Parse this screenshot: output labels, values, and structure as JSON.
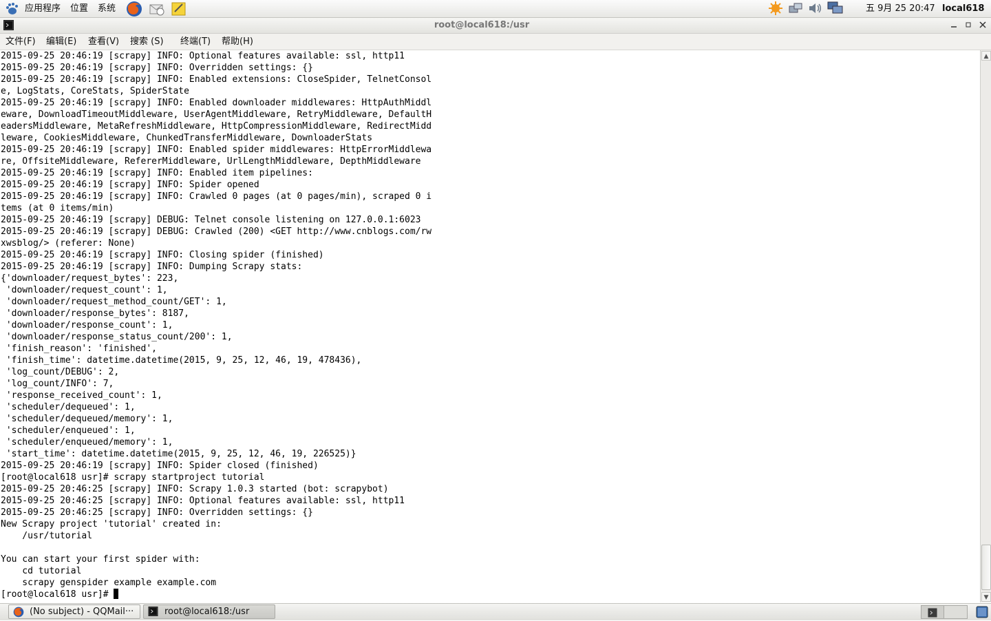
{
  "top_panel": {
    "menus": [
      "应用程序",
      "位置",
      "系统"
    ],
    "clock": "五 9月 25 20:47",
    "user": "local618",
    "launchers": [
      "firefox-icon",
      "mail-icon",
      "notes-icon"
    ],
    "tray": [
      "update-icon",
      "network-icon",
      "volume-icon",
      "display-icon"
    ]
  },
  "window": {
    "title": "root@local618:/usr",
    "buttons": [
      "minimize",
      "maximize",
      "close"
    ]
  },
  "menubar": {
    "items": [
      "文件(F)",
      "编辑(E)",
      "查看(V)",
      "搜索 (S)",
      "终端(T)",
      "帮助(H)"
    ]
  },
  "terminal": {
    "lines": [
      "2015-09-25 20:46:19 [scrapy] INFO: Optional features available: ssl, http11",
      "2015-09-25 20:46:19 [scrapy] INFO: Overridden settings: {}",
      "2015-09-25 20:46:19 [scrapy] INFO: Enabled extensions: CloseSpider, TelnetConsol",
      "e, LogStats, CoreStats, SpiderState",
      "2015-09-25 20:46:19 [scrapy] INFO: Enabled downloader middlewares: HttpAuthMiddl",
      "eware, DownloadTimeoutMiddleware, UserAgentMiddleware, RetryMiddleware, DefaultH",
      "eadersMiddleware, MetaRefreshMiddleware, HttpCompressionMiddleware, RedirectMidd",
      "leware, CookiesMiddleware, ChunkedTransferMiddleware, DownloaderStats",
      "2015-09-25 20:46:19 [scrapy] INFO: Enabled spider middlewares: HttpErrorMiddlewa",
      "re, OffsiteMiddleware, RefererMiddleware, UrlLengthMiddleware, DepthMiddleware",
      "2015-09-25 20:46:19 [scrapy] INFO: Enabled item pipelines:",
      "2015-09-25 20:46:19 [scrapy] INFO: Spider opened",
      "2015-09-25 20:46:19 [scrapy] INFO: Crawled 0 pages (at 0 pages/min), scraped 0 i",
      "tems (at 0 items/min)",
      "2015-09-25 20:46:19 [scrapy] DEBUG: Telnet console listening on 127.0.0.1:6023",
      "2015-09-25 20:46:19 [scrapy] DEBUG: Crawled (200) <GET http://www.cnblogs.com/rw",
      "xwsblog/> (referer: None)",
      "2015-09-25 20:46:19 [scrapy] INFO: Closing spider (finished)",
      "2015-09-25 20:46:19 [scrapy] INFO: Dumping Scrapy stats:",
      "{'downloader/request_bytes': 223,",
      " 'downloader/request_count': 1,",
      " 'downloader/request_method_count/GET': 1,",
      " 'downloader/response_bytes': 8187,",
      " 'downloader/response_count': 1,",
      " 'downloader/response_status_count/200': 1,",
      " 'finish_reason': 'finished',",
      " 'finish_time': datetime.datetime(2015, 9, 25, 12, 46, 19, 478436),",
      " 'log_count/DEBUG': 2,",
      " 'log_count/INFO': 7,",
      " 'response_received_count': 1,",
      " 'scheduler/dequeued': 1,",
      " 'scheduler/dequeued/memory': 1,",
      " 'scheduler/enqueued': 1,",
      " 'scheduler/enqueued/memory': 1,",
      " 'start_time': datetime.datetime(2015, 9, 25, 12, 46, 19, 226525)}",
      "2015-09-25 20:46:19 [scrapy] INFO: Spider closed (finished)",
      "[root@local618 usr]# scrapy startproject tutorial",
      "2015-09-25 20:46:25 [scrapy] INFO: Scrapy 1.0.3 started (bot: scrapybot)",
      "2015-09-25 20:46:25 [scrapy] INFO: Optional features available: ssl, http11",
      "2015-09-25 20:46:25 [scrapy] INFO: Overridden settings: {}",
      "New Scrapy project 'tutorial' created in:",
      "    /usr/tutorial",
      "",
      "You can start your first spider with:",
      "    cd tutorial",
      "    scrapy genspider example example.com"
    ],
    "prompt": "[root@local618 usr]# "
  },
  "taskbar": {
    "tasks": [
      {
        "label": "(No subject) - QQMail···",
        "icon": "firefox-icon"
      },
      {
        "label": "root@local618:/usr",
        "icon": "terminal-icon"
      }
    ]
  }
}
